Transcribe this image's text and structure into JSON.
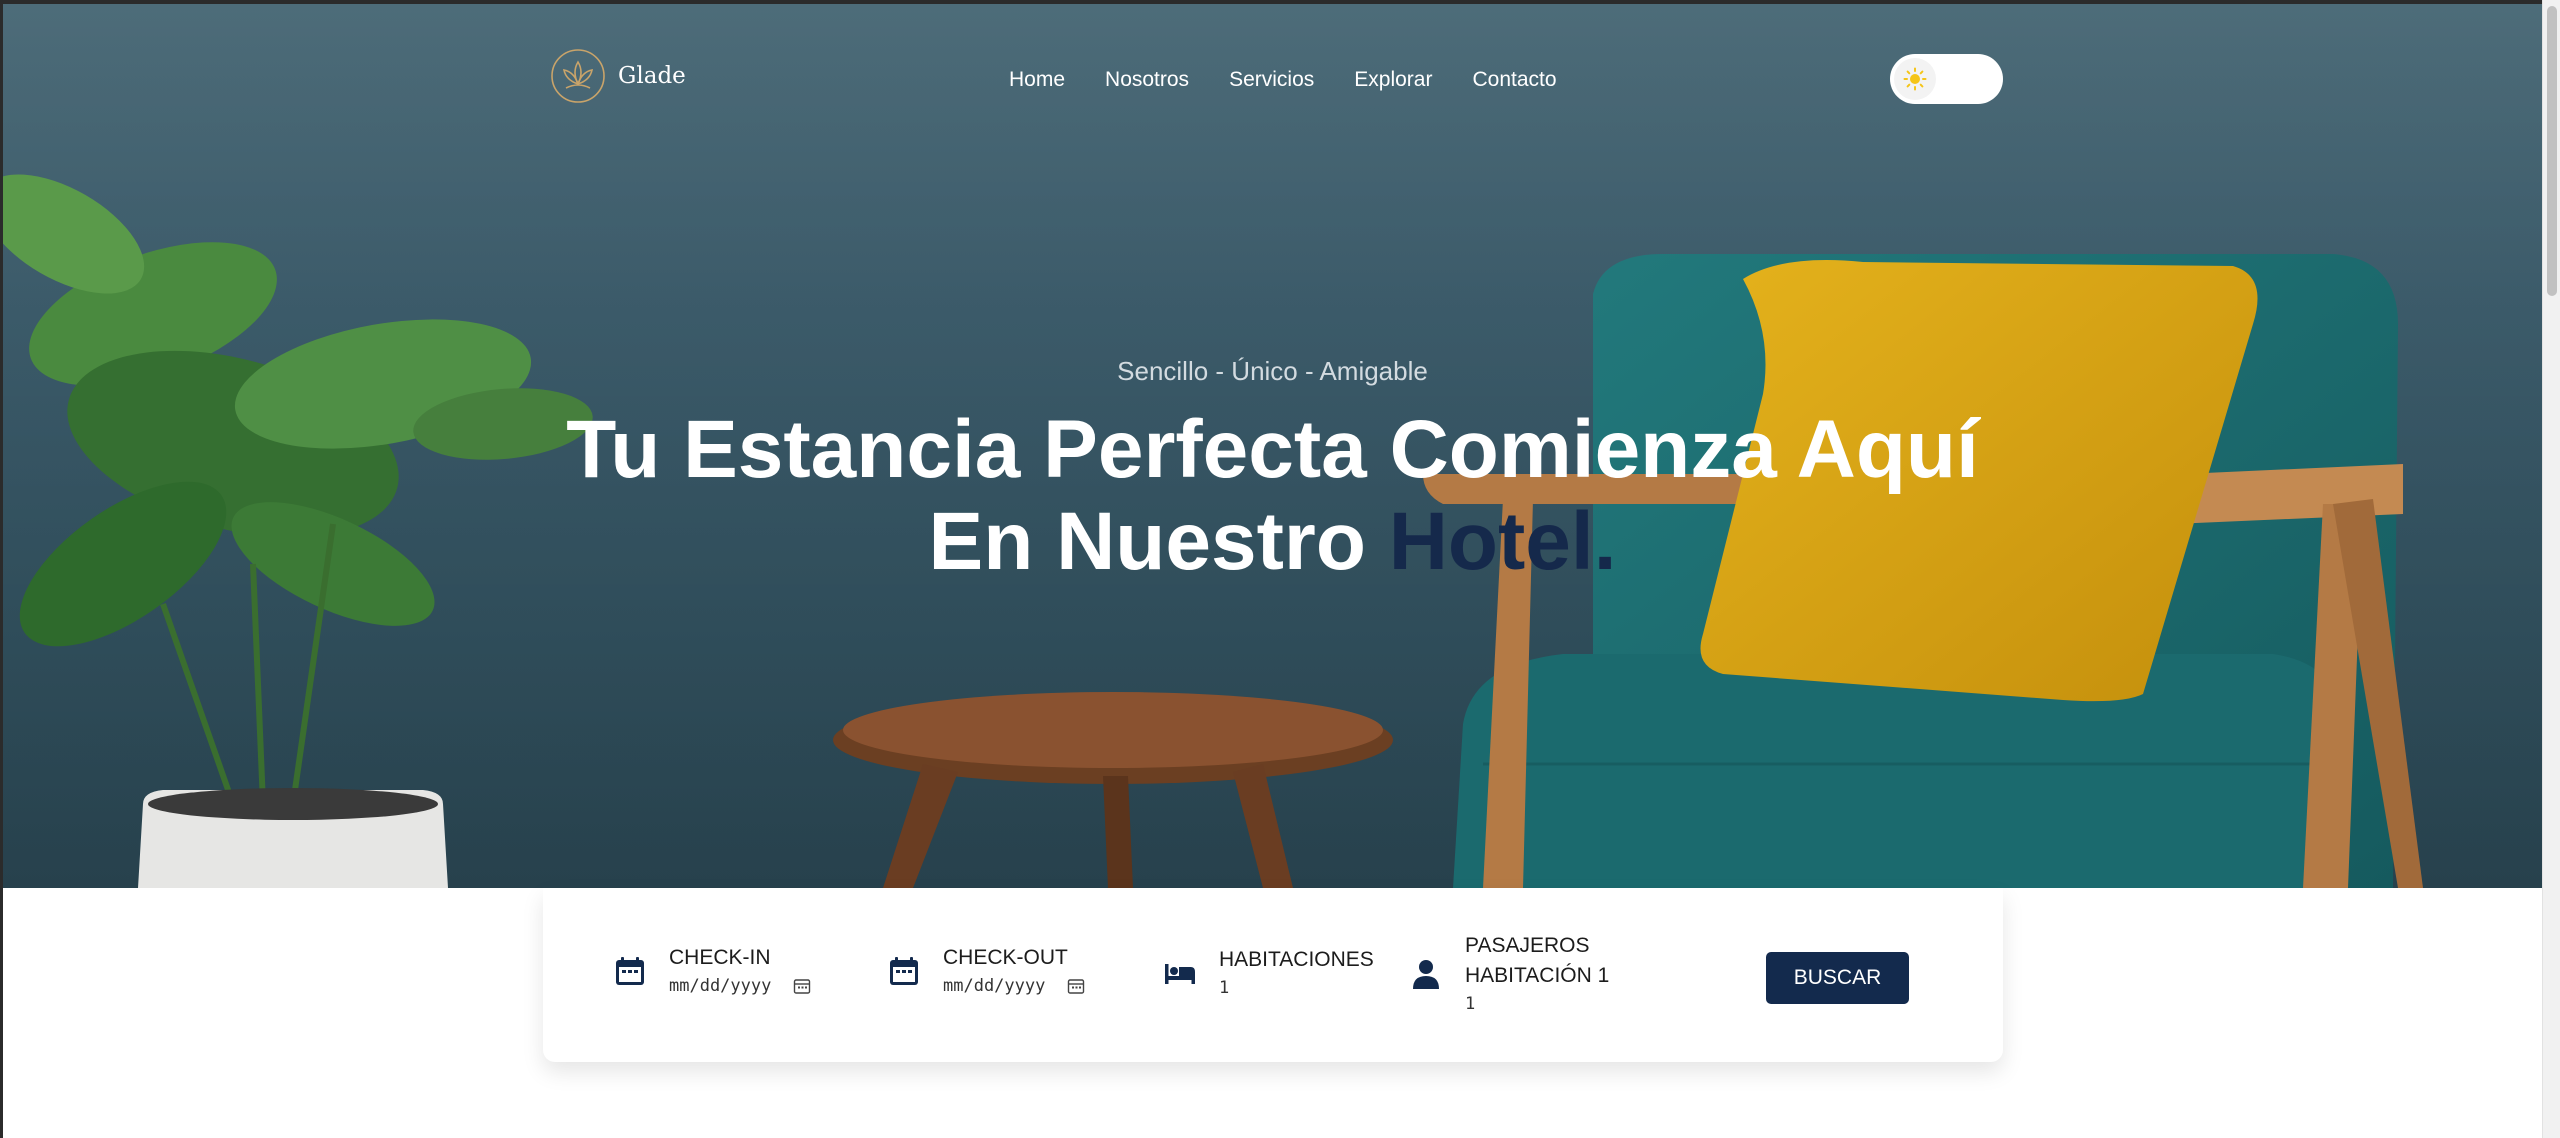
{
  "brand": {
    "name": "Glade"
  },
  "nav": {
    "items": [
      {
        "label": "Home"
      },
      {
        "label": "Nosotros"
      },
      {
        "label": "Servicios"
      },
      {
        "label": "Explorar"
      },
      {
        "label": "Contacto"
      }
    ],
    "theme_toggle_icon": "sun-icon"
  },
  "hero": {
    "tagline": "Sencillo - Único - Amigable",
    "title_line1": "Tu Estancia Perfecta Comienza Aquí",
    "title_line2_prefix": "En Nuestro ",
    "title_accent": "Hotel."
  },
  "booking": {
    "checkin": {
      "label": "CHECK-IN",
      "value": "mm/dd/yyyy",
      "icon": "calendar-icon"
    },
    "checkout": {
      "label": "CHECK-OUT",
      "value": "mm/dd/yyyy",
      "icon": "calendar-icon"
    },
    "rooms": {
      "label": "HABITACIONES",
      "value": "1",
      "icon": "bed-icon"
    },
    "guests": {
      "label_line1": "PASAJEROS",
      "label_line2": "HABITACIÓN 1",
      "value": "1",
      "icon": "person-icon"
    },
    "search_label": "BUSCAR"
  },
  "colors": {
    "accent_navy": "#132a4d",
    "logo_gold": "#c9a46a",
    "wall_teal": "#3f6070",
    "pillow_mustard": "#d4a017",
    "chair_teal": "#1f6f73"
  }
}
